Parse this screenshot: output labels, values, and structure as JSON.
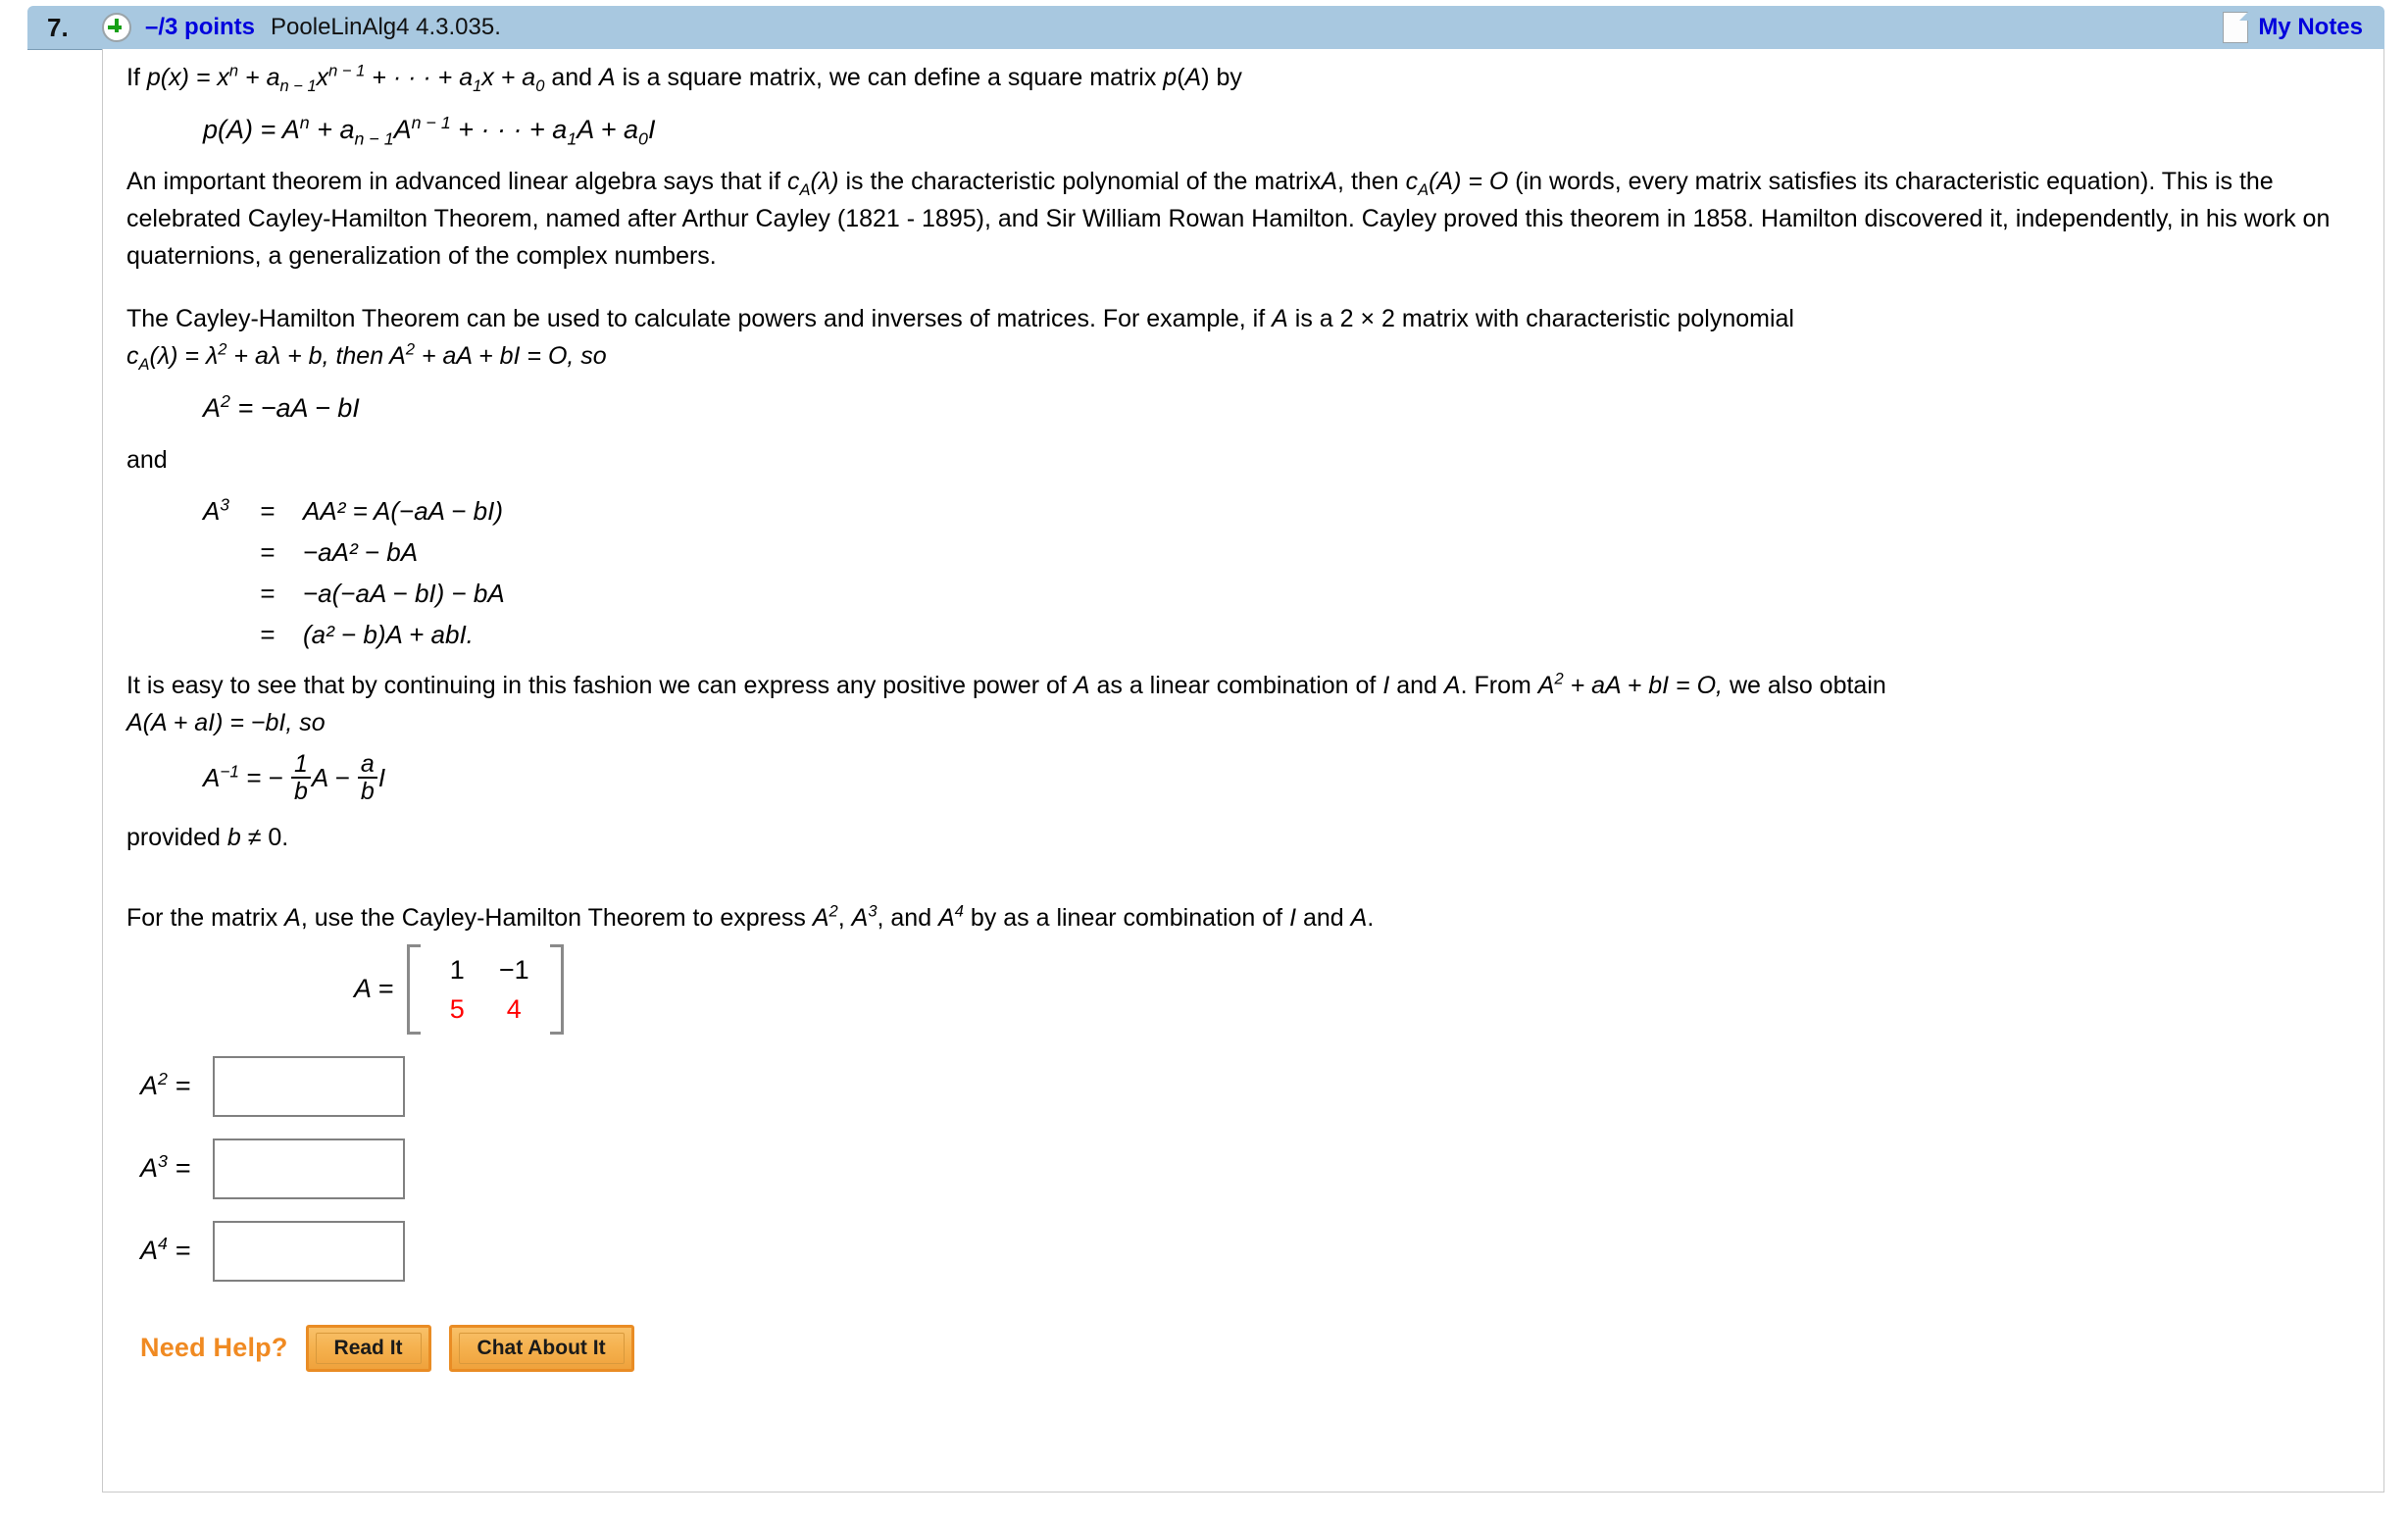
{
  "header": {
    "question_number": "7.",
    "expand_icon": "plus-circle-icon",
    "points": "–/3 points",
    "reference": "PooleLinAlg4 4.3.035.",
    "notes_icon": "note-page-icon",
    "notes_label": "My Notes"
  },
  "body": {
    "intro_prefix": "If",
    "eq_px": "p(x) = x",
    "eq_px_sup1": "n",
    "eq_px_mid": " + a",
    "eq_px_sub1": "n − 1",
    "eq_px_x": "x",
    "eq_px_sup2": "n − 1",
    "eq_px_dots": " + · · · + a",
    "eq_px_sub2": "1",
    "eq_px_tail": "x + a",
    "eq_px_sub3": "0",
    "intro_suffix": "and A is a square matrix, we can define a square matrix p(A) by",
    "eq_pA": {
      "lhs": "p(A) = A",
      "sup1": "n",
      "mid": " + a",
      "sub1": "n − 1",
      "term": "A",
      "sup2": "n − 1",
      "dots": " + · · · + a",
      "sub2": "1",
      "tail": "A + a",
      "sub3": "0",
      "end": "I"
    },
    "para1_a": "An important theorem in advanced linear algebra says that if",
    "para1_cA_lam": "c",
    "para1_cA_lam_sub": "A",
    "para1_cA_lam_arg": "(λ)",
    "para1_b": "is the characteristic polynomial of the matrix",
    "para1_A": "A",
    "para1_c": ", then",
    "para1_cA_A": "c",
    "para1_cA_A_sub": "A",
    "para1_cA_A_arg": "(A) = O",
    "para1_d": "(in words, every matrix satisfies its characteristic equation). This is the celebrated Cayley-Hamilton Theorem, named after Arthur Cayley (1821 - 1895), and Sir William Rowan Hamilton. Cayley proved this theorem in 1858. Hamilton discovered it, independently, in his work on quaternions, a generalization of the complex numbers.",
    "para2_a": "The Cayley-Hamilton Theorem can be used to calculate powers and inverses of matrices. For example, if",
    "para2_A": "A",
    "para2_b": "is a 2 × 2 matrix with characteristic polynomial",
    "para2_line2_c": "c",
    "para2_line2_sub": "A",
    "para2_line2_rest": "(λ) = λ",
    "para2_line2_sup": "2",
    "para2_line2_rest2": " + aλ + b,  then  A",
    "para2_line2_sup2": "2",
    "para2_line2_rest3": " + aA + bI = O,  so",
    "eq_A2": {
      "lhs": "A",
      "sup": "2",
      "rhs": " = −aA − bI"
    },
    "and_word": "and",
    "eq_A3": {
      "lhs": "A",
      "lhs_sup": "3",
      "eq": "=",
      "rows": [
        "AA² = A(−aA − bI)",
        "−aA² − bA",
        "−a(−aA − bI) − bA",
        "(a² − b)A + abI."
      ]
    },
    "para3_a": "It is easy to see that by continuing in this fashion we can express any positive power of",
    "para3_A": "A",
    "para3_b": "as a linear combination of",
    "para3_I": "I",
    "para3_c": "and",
    "para3_A2": "A",
    "para3_d": ". From",
    "para3_eq": "A",
    "para3_eq_sup": "2",
    "para3_eq_rest": " + aA + bI = O,",
    "para3_e": "we also obtain",
    "para3_line2": "A(A + aI) = −bI,  so",
    "eq_Ainv": {
      "lhs": "A",
      "sup": "−1",
      "eq": " = −",
      "frac1_num": "1",
      "frac1_den": "b",
      "mid": "A −",
      "frac2_num": "a",
      "frac2_den": "b",
      "tail": "I"
    },
    "provided": "provided b ≠ 0.",
    "question_a": "For the matrix",
    "question_A": "A",
    "question_b": ", use the Cayley-Hamilton Theorem to express",
    "question_A2": "A",
    "question_A2_sup": "2",
    "question_sep1": ",",
    "question_A3": "A",
    "question_A3_sup": "3",
    "question_sep2": ", and",
    "question_A4": "A",
    "question_A4_sup": "4",
    "question_c": "by as a linear combination of",
    "question_I": "I",
    "question_d": "and",
    "question_A5": "A",
    "question_end": "."
  },
  "matrix": {
    "label": "A  =",
    "rows": [
      {
        "cells": [
          "1",
          "−1"
        ],
        "color": "#000000"
      },
      {
        "cells": [
          "5",
          "4"
        ],
        "color": "#ff0000"
      }
    ],
    "highlight_color": "#ff0000"
  },
  "answers": [
    {
      "label_base": "A",
      "label_sup": "2",
      "equals": "=",
      "value": "",
      "placeholder": ""
    },
    {
      "label_base": "A",
      "label_sup": "3",
      "equals": "=",
      "value": "",
      "placeholder": ""
    },
    {
      "label_base": "A",
      "label_sup": "4",
      "equals": "=",
      "value": "",
      "placeholder": ""
    }
  ],
  "help": {
    "label": "Need Help?",
    "read_it": "Read It",
    "chat_about_it": "Chat About It",
    "accent_color": "#f08a22"
  }
}
